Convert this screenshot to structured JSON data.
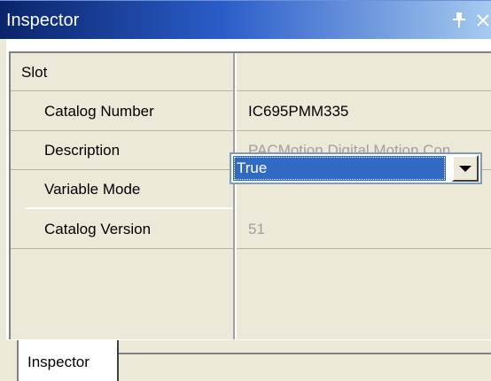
{
  "window": {
    "title": "Inspector"
  },
  "properties": {
    "category": "Slot",
    "rows": [
      {
        "name": "Catalog Number",
        "value": "IC695PMM335",
        "readonly": false
      },
      {
        "name": "Description",
        "value": "PACMotion Digital Motion Con",
        "readonly": true
      },
      {
        "name": "Variable Mode",
        "value": "True",
        "readonly": false,
        "type": "dropdown"
      },
      {
        "name": "Catalog Version",
        "value": "51",
        "readonly": true
      }
    ]
  },
  "tabs": [
    {
      "label": "Inspector",
      "active": true
    }
  ],
  "colors": {
    "title_gradient_start": "#0a246a",
    "title_gradient_end": "#a6caf0",
    "selection": "#316ac5",
    "readonly_text": "#a0a0a0",
    "panel_background": "#ece9d8"
  },
  "icons": {
    "pin": "pin-icon",
    "close": "close-icon",
    "dropdown": "chevron-down-icon"
  }
}
